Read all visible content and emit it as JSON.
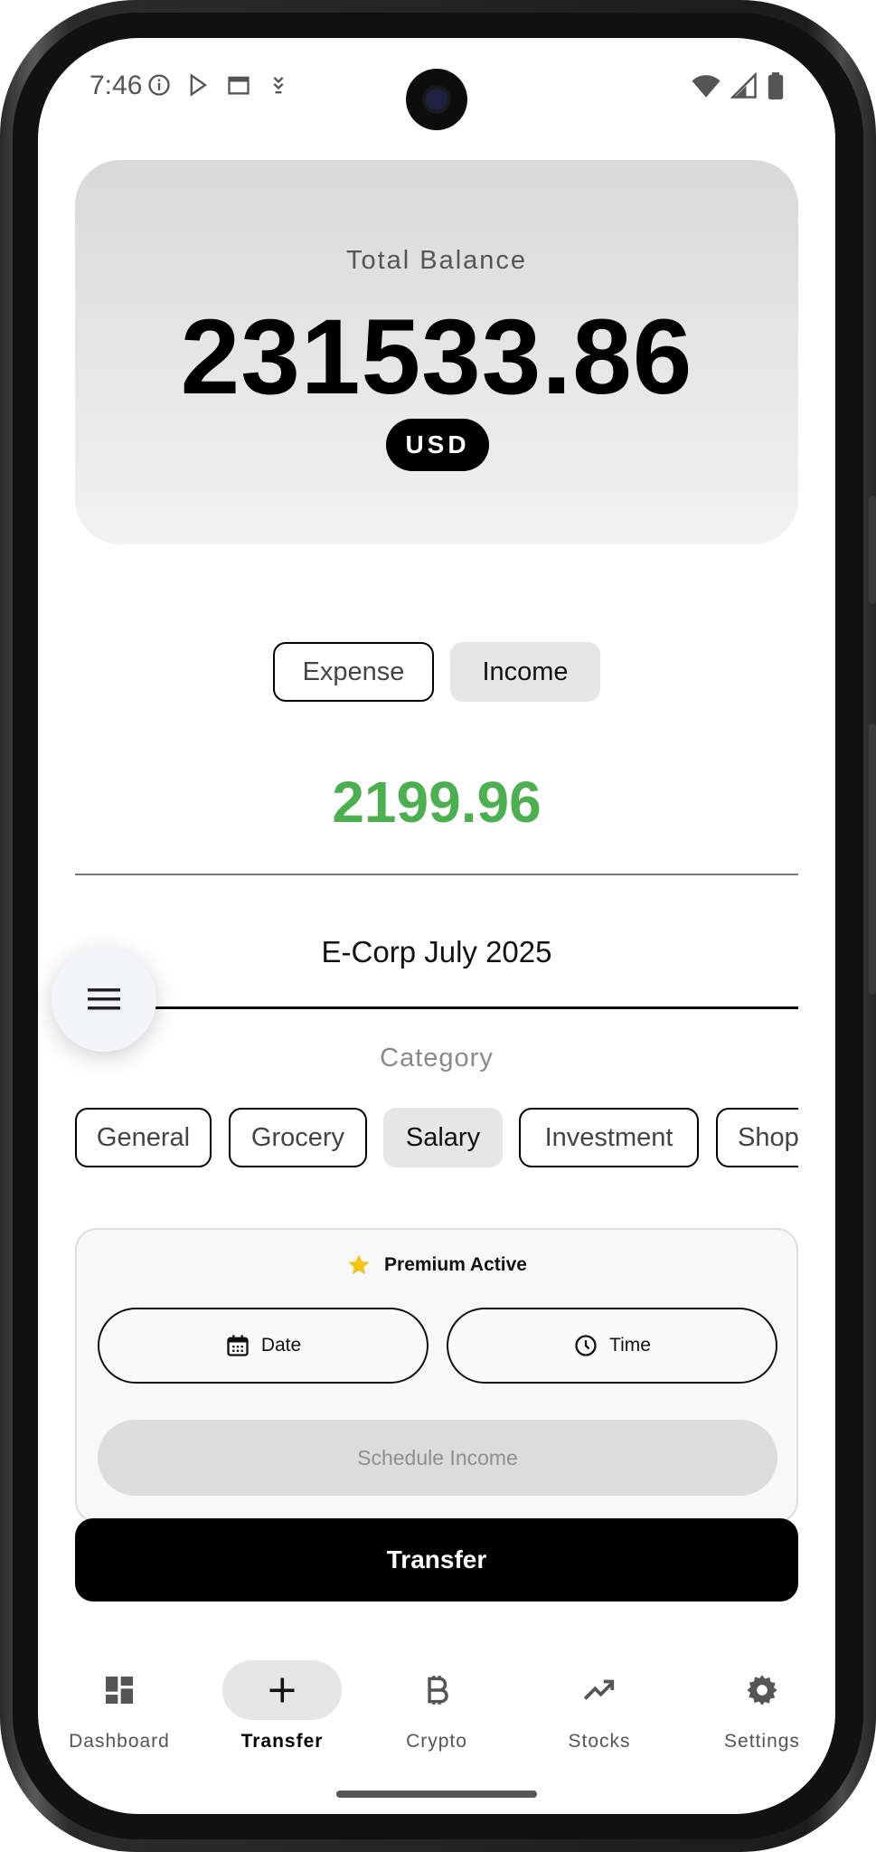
{
  "status_bar": {
    "time": "7:46"
  },
  "balance": {
    "label": "Total Balance",
    "value": "231533.86",
    "currency": "USD"
  },
  "type_toggle": {
    "expense_label": "Expense",
    "income_label": "Income",
    "selected": "Income"
  },
  "amount": {
    "value": "2199.96",
    "color": "#4caf50"
  },
  "description": {
    "value": "E-Corp July 2025"
  },
  "category": {
    "label": "Category",
    "chips": [
      "General",
      "Grocery",
      "Salary",
      "Investment",
      "Shopping"
    ],
    "selected": "Salary"
  },
  "premium": {
    "title": "Premium Active",
    "date_label": "Date",
    "time_label": "Time",
    "schedule_label": "Schedule Income",
    "star_color": "#f5c518"
  },
  "transfer_button": {
    "label": "Transfer"
  },
  "nav": {
    "items": [
      {
        "label": "Dashboard",
        "icon": "dashboard-icon"
      },
      {
        "label": "Transfer",
        "icon": "plus-icon",
        "active": true
      },
      {
        "label": "Crypto",
        "icon": "bitcoin-icon"
      },
      {
        "label": "Stocks",
        "icon": "trending-up-icon"
      },
      {
        "label": "Settings",
        "icon": "gear-icon"
      }
    ]
  }
}
